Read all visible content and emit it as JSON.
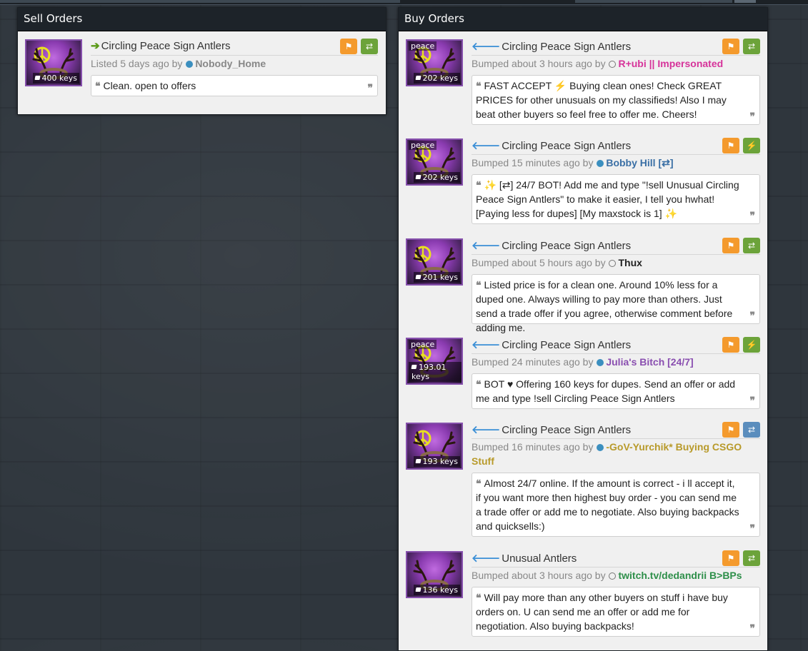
{
  "sections": {
    "sell_title": "Sell Orders",
    "buy_title": "Buy Orders"
  },
  "sell_orders": [
    {
      "title": "Circling Peace Sign Antlers",
      "direction_icon": "arrow-right-icon",
      "tag": "",
      "price": "400 keys",
      "meta_prefix": "Listed 5 days ago by",
      "user": "Nobody_Home",
      "user_status": "online",
      "user_color": "#888888",
      "comment": "Clean. open to offers",
      "trade_type": "trade"
    }
  ],
  "buy_orders": [
    {
      "title": "Circling Peace Sign Antlers",
      "tag": "peace",
      "price": "202 keys",
      "meta_prefix": "Bumped about 3 hours ago by",
      "user": "R+ubi || Impersonated",
      "user_status": "offline",
      "user_color": "#d6339a",
      "comment": "FAST ACCEPT ⚡ Buying clean ones! Check GREAT PRICES for other unusuals on my classifieds! Also I may beat other buyers so feel free to offer me. Cheers!",
      "trade_type": "trade"
    },
    {
      "title": "Circling Peace Sign Antlers",
      "tag": "peace",
      "price": "202 keys",
      "meta_prefix": "Bumped 15 minutes ago by",
      "user": "Bobby Hill [⇄]",
      "user_status": "online",
      "user_color": "#3a6fa5",
      "comment": "✨ [⇄] 24/7 BOT! Add me and type \"!sell Unusual Circling Peace Sign Antlers\" to make it easier, I tell you hwhat! [Paying less for dupes] [My maxstock is 1] ✨",
      "trade_type": "instant"
    },
    {
      "title": "Circling Peace Sign Antlers",
      "tag": "",
      "price": "201 keys",
      "meta_prefix": "Bumped about 5 hours ago by",
      "user": "Thux",
      "user_status": "offline",
      "user_color": "#222222",
      "comment": "Listed price is for a clean one. Around 10% less for a duped one. Always willing to pay more than others. Just send a trade offer if you agree, otherwise comment before adding me.",
      "trade_type": "trade"
    },
    {
      "title": "Circling Peace Sign Antlers",
      "tag": "peace",
      "price": "193.01 keys",
      "meta_prefix": "Bumped 24 minutes ago by",
      "user": "Julia's Bitch [24/7]",
      "user_status": "online",
      "user_color": "#8a4fb0",
      "comment": "BOT ♥ Offering 160 keys for dupes. Send an offer or add me and type !sell Circling Peace Sign Antlers",
      "trade_type": "instant"
    },
    {
      "title": "Circling Peace Sign Antlers",
      "tag": "",
      "price": "193 keys",
      "meta_prefix": "Bumped 16 minutes ago by",
      "user": "-GoV-Yurchik* Buying CSGO Stuff",
      "user_status": "online",
      "user_color": "#b89a2a",
      "comment": "Almost 24/7 online. If the amount is correct - i ll accept it, if you want more then highest buy order - you can send me a trade offer or add me to negotiate. Also buying backpacks and quicksells:)",
      "trade_type": "trade-blue"
    },
    {
      "title": "Unusual Antlers",
      "tag": "",
      "price": "136 keys",
      "meta_prefix": "Bumped about 3 hours ago by",
      "user": "twitch.tv/dedandrii B>BPs",
      "user_status": "offline",
      "user_color": "#2e8f4a",
      "comment": "Will pay more than any other buyers on stuff i have buy orders on. U can send me an offer or add me for negotiation. Also buying backpacks!",
      "trade_type": "trade"
    }
  ],
  "icons": {
    "flag": "flag-icon",
    "trade": "exchange-icon",
    "instant": "lightning-icon",
    "quote_open": "quote-open-icon",
    "quote_close": "quote-close-icon",
    "price_tag": "price-tag-icon"
  },
  "colors": {
    "flag_button": "#f49a2d",
    "trade_button_blue": "#5a8dbd",
    "trade_button_green": "#6ca33a",
    "thumb_border": "#8650ac",
    "panel_header": "#1d2329"
  }
}
